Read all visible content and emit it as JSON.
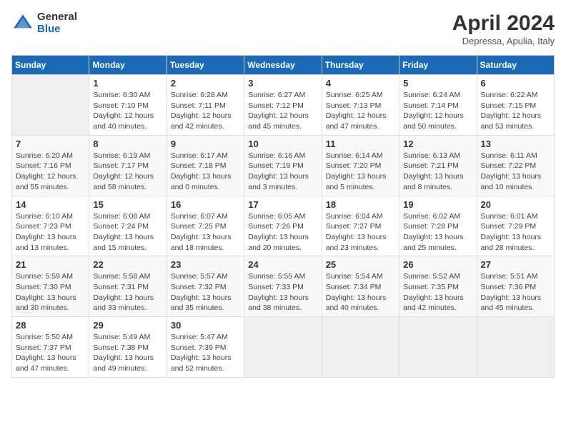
{
  "header": {
    "logo_general": "General",
    "logo_blue": "Blue",
    "month_title": "April 2024",
    "location": "Depressa, Apulia, Italy"
  },
  "columns": [
    "Sunday",
    "Monday",
    "Tuesday",
    "Wednesday",
    "Thursday",
    "Friday",
    "Saturday"
  ],
  "weeks": [
    [
      {
        "day": "",
        "info": ""
      },
      {
        "day": "1",
        "info": "Sunrise: 6:30 AM\nSunset: 7:10 PM\nDaylight: 12 hours\nand 40 minutes."
      },
      {
        "day": "2",
        "info": "Sunrise: 6:28 AM\nSunset: 7:11 PM\nDaylight: 12 hours\nand 42 minutes."
      },
      {
        "day": "3",
        "info": "Sunrise: 6:27 AM\nSunset: 7:12 PM\nDaylight: 12 hours\nand 45 minutes."
      },
      {
        "day": "4",
        "info": "Sunrise: 6:25 AM\nSunset: 7:13 PM\nDaylight: 12 hours\nand 47 minutes."
      },
      {
        "day": "5",
        "info": "Sunrise: 6:24 AM\nSunset: 7:14 PM\nDaylight: 12 hours\nand 50 minutes."
      },
      {
        "day": "6",
        "info": "Sunrise: 6:22 AM\nSunset: 7:15 PM\nDaylight: 12 hours\nand 53 minutes."
      }
    ],
    [
      {
        "day": "7",
        "info": "Sunrise: 6:20 AM\nSunset: 7:16 PM\nDaylight: 12 hours\nand 55 minutes."
      },
      {
        "day": "8",
        "info": "Sunrise: 6:19 AM\nSunset: 7:17 PM\nDaylight: 12 hours\nand 58 minutes."
      },
      {
        "day": "9",
        "info": "Sunrise: 6:17 AM\nSunset: 7:18 PM\nDaylight: 13 hours\nand 0 minutes."
      },
      {
        "day": "10",
        "info": "Sunrise: 6:16 AM\nSunset: 7:19 PM\nDaylight: 13 hours\nand 3 minutes."
      },
      {
        "day": "11",
        "info": "Sunrise: 6:14 AM\nSunset: 7:20 PM\nDaylight: 13 hours\nand 5 minutes."
      },
      {
        "day": "12",
        "info": "Sunrise: 6:13 AM\nSunset: 7:21 PM\nDaylight: 13 hours\nand 8 minutes."
      },
      {
        "day": "13",
        "info": "Sunrise: 6:11 AM\nSunset: 7:22 PM\nDaylight: 13 hours\nand 10 minutes."
      }
    ],
    [
      {
        "day": "14",
        "info": "Sunrise: 6:10 AM\nSunset: 7:23 PM\nDaylight: 13 hours\nand 13 minutes."
      },
      {
        "day": "15",
        "info": "Sunrise: 6:08 AM\nSunset: 7:24 PM\nDaylight: 13 hours\nand 15 minutes."
      },
      {
        "day": "16",
        "info": "Sunrise: 6:07 AM\nSunset: 7:25 PM\nDaylight: 13 hours\nand 18 minutes."
      },
      {
        "day": "17",
        "info": "Sunrise: 6:05 AM\nSunset: 7:26 PM\nDaylight: 13 hours\nand 20 minutes."
      },
      {
        "day": "18",
        "info": "Sunrise: 6:04 AM\nSunset: 7:27 PM\nDaylight: 13 hours\nand 23 minutes."
      },
      {
        "day": "19",
        "info": "Sunrise: 6:02 AM\nSunset: 7:28 PM\nDaylight: 13 hours\nand 25 minutes."
      },
      {
        "day": "20",
        "info": "Sunrise: 6:01 AM\nSunset: 7:29 PM\nDaylight: 13 hours\nand 28 minutes."
      }
    ],
    [
      {
        "day": "21",
        "info": "Sunrise: 5:59 AM\nSunset: 7:30 PM\nDaylight: 13 hours\nand 30 minutes."
      },
      {
        "day": "22",
        "info": "Sunrise: 5:58 AM\nSunset: 7:31 PM\nDaylight: 13 hours\nand 33 minutes."
      },
      {
        "day": "23",
        "info": "Sunrise: 5:57 AM\nSunset: 7:32 PM\nDaylight: 13 hours\nand 35 minutes."
      },
      {
        "day": "24",
        "info": "Sunrise: 5:55 AM\nSunset: 7:33 PM\nDaylight: 13 hours\nand 38 minutes."
      },
      {
        "day": "25",
        "info": "Sunrise: 5:54 AM\nSunset: 7:34 PM\nDaylight: 13 hours\nand 40 minutes."
      },
      {
        "day": "26",
        "info": "Sunrise: 5:52 AM\nSunset: 7:35 PM\nDaylight: 13 hours\nand 42 minutes."
      },
      {
        "day": "27",
        "info": "Sunrise: 5:51 AM\nSunset: 7:36 PM\nDaylight: 13 hours\nand 45 minutes."
      }
    ],
    [
      {
        "day": "28",
        "info": "Sunrise: 5:50 AM\nSunset: 7:37 PM\nDaylight: 13 hours\nand 47 minutes."
      },
      {
        "day": "29",
        "info": "Sunrise: 5:49 AM\nSunset: 7:38 PM\nDaylight: 13 hours\nand 49 minutes."
      },
      {
        "day": "30",
        "info": "Sunrise: 5:47 AM\nSunset: 7:39 PM\nDaylight: 13 hours\nand 52 minutes."
      },
      {
        "day": "",
        "info": ""
      },
      {
        "day": "",
        "info": ""
      },
      {
        "day": "",
        "info": ""
      },
      {
        "day": "",
        "info": ""
      }
    ]
  ]
}
